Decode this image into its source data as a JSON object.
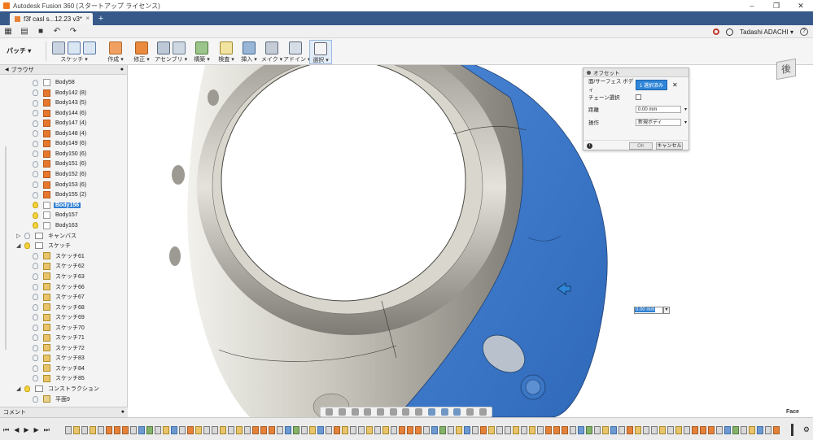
{
  "window": {
    "title": "Autodesk Fusion 360 (スタートアップ ライセンス)"
  },
  "tab": {
    "label": "f3f casl s...12.23  v3*",
    "close": "×",
    "new": "+"
  },
  "user": {
    "name": "Tadashi ADACHI ▾"
  },
  "workspace": {
    "label": "パッチ ▾"
  },
  "ribbon": {
    "groups": [
      {
        "label": "スケッチ ▾"
      },
      {
        "label": "作成 ▾"
      },
      {
        "label": "修正 ▾"
      },
      {
        "label": "アセンブリ ▾"
      },
      {
        "label": "構築 ▾"
      },
      {
        "label": "検査 ▾"
      },
      {
        "label": "挿入 ▾"
      },
      {
        "label": "メイク ▾"
      },
      {
        "label": "アドイン ▾"
      },
      {
        "label": "選択 ▾"
      }
    ]
  },
  "browser": {
    "title": "ブラウザ",
    "bodies": [
      {
        "label": "Body58",
        "type": "plain"
      },
      {
        "label": "Body142 (8)",
        "type": "orange"
      },
      {
        "label": "Body143 (5)",
        "type": "orange"
      },
      {
        "label": "Body144 (6)",
        "type": "orange"
      },
      {
        "label": "Body147 (4)",
        "type": "orange"
      },
      {
        "label": "Body148 (4)",
        "type": "orange"
      },
      {
        "label": "Body149 (6)",
        "type": "orange"
      },
      {
        "label": "Body150 (6)",
        "type": "orange"
      },
      {
        "label": "Body151 (6)",
        "type": "orange"
      },
      {
        "label": "Body152 (6)",
        "type": "orange"
      },
      {
        "label": "Body153 (6)",
        "type": "orange"
      },
      {
        "label": "Body155 (2)",
        "type": "orange"
      },
      {
        "label": "Body156",
        "type": "plain",
        "selected": true
      },
      {
        "label": "Body157",
        "type": "plain"
      },
      {
        "label": "Body163",
        "type": "plain"
      }
    ],
    "canvas_folder": "キャンバス",
    "sketch_folder": "スケッチ",
    "sketches": [
      "スケッチ61",
      "スケッチ62",
      "スケッチ63",
      "スケッチ66",
      "スケッチ67",
      "スケッチ68",
      "スケッチ69",
      "スケッチ70",
      "スケッチ71",
      "スケッチ72",
      "スケッチ83",
      "スケッチ84",
      "スケッチ85"
    ],
    "construction_folder": "コンストラクション",
    "plane": "平面9"
  },
  "comments": {
    "label": "コメント"
  },
  "offset_dialog": {
    "title": "オフセット",
    "face_label": "面/サーフェス ボディ",
    "select_btn": "1 選択済み",
    "chain_label": "チェーン選択",
    "distance_label": "距離",
    "distance_value": "0.00 mm",
    "operation_label": "操作",
    "operation_value": "新規ボディ",
    "ok": "OK",
    "cancel": "キャンセル"
  },
  "float_input": {
    "value": "0.00 mm"
  },
  "viewcube": {
    "face": "後"
  },
  "status": {
    "selection": "Face"
  },
  "colors": {
    "selection_blue": "#3f7bd0",
    "tab_strip": "#36598a",
    "accent_orange": "#e6782d"
  }
}
